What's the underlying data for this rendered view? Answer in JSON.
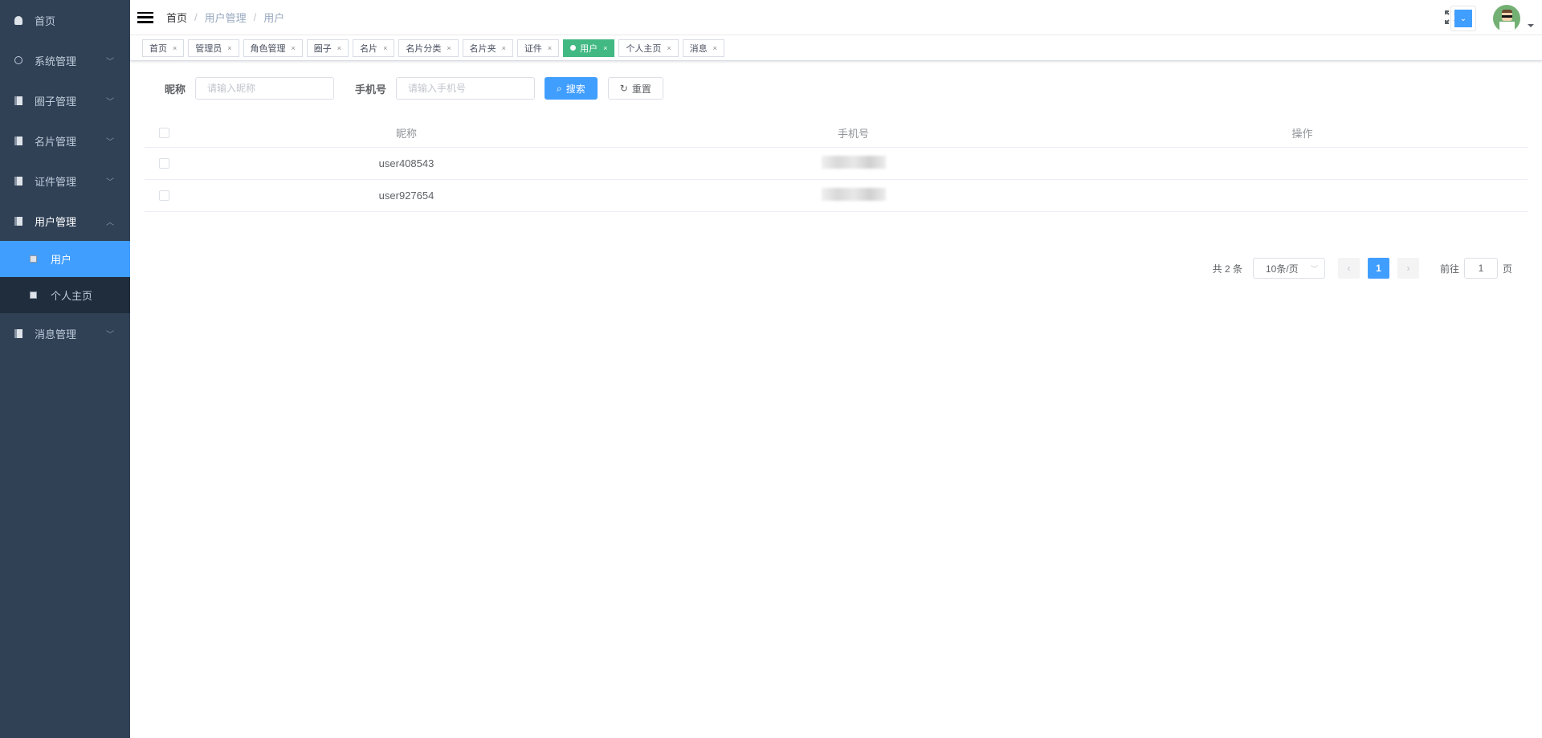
{
  "sidebar": {
    "items": [
      {
        "label": "首页",
        "icon": "dashboard-icon"
      },
      {
        "label": "系统管理",
        "icon": "gear-icon"
      },
      {
        "label": "圈子管理",
        "icon": "book-icon"
      },
      {
        "label": "名片管理",
        "icon": "book-icon"
      },
      {
        "label": "证件管理",
        "icon": "book-icon"
      },
      {
        "label": "用户管理",
        "icon": "book-icon"
      },
      {
        "label": "消息管理",
        "icon": "book-icon"
      }
    ],
    "sub_items": [
      {
        "label": "用户",
        "active": true
      },
      {
        "label": "个人主页",
        "active": false
      }
    ],
    "colors": {
      "background": "#304156",
      "active": "#409EFF"
    }
  },
  "header": {
    "breadcrumb": [
      "首页",
      "用户管理",
      "用户"
    ],
    "breadcrumb_separator": "/"
  },
  "tags": [
    "首页",
    "管理员",
    "角色管理",
    "圈子",
    "名片",
    "名片分类",
    "名片夹",
    "证件",
    "用户",
    "个人主页",
    "消息"
  ],
  "active_tag": "用户",
  "tag_close": "×",
  "search": {
    "nickname_label": "昵称",
    "nickname_placeholder": "请输入昵称",
    "phone_label": "手机号",
    "phone_placeholder": "请输入手机号",
    "search_button": "搜索",
    "reset_button": "重置"
  },
  "table": {
    "columns": [
      "昵称",
      "手机号",
      "操作"
    ],
    "rows": [
      {
        "nickname": "user408543"
      },
      {
        "nickname": "user927654"
      }
    ]
  },
  "pagination": {
    "total": "共 2 条",
    "page_size": "10条/页",
    "current_page": "1",
    "goto_label": "前往",
    "goto_value": "1",
    "page_suffix": "页"
  }
}
